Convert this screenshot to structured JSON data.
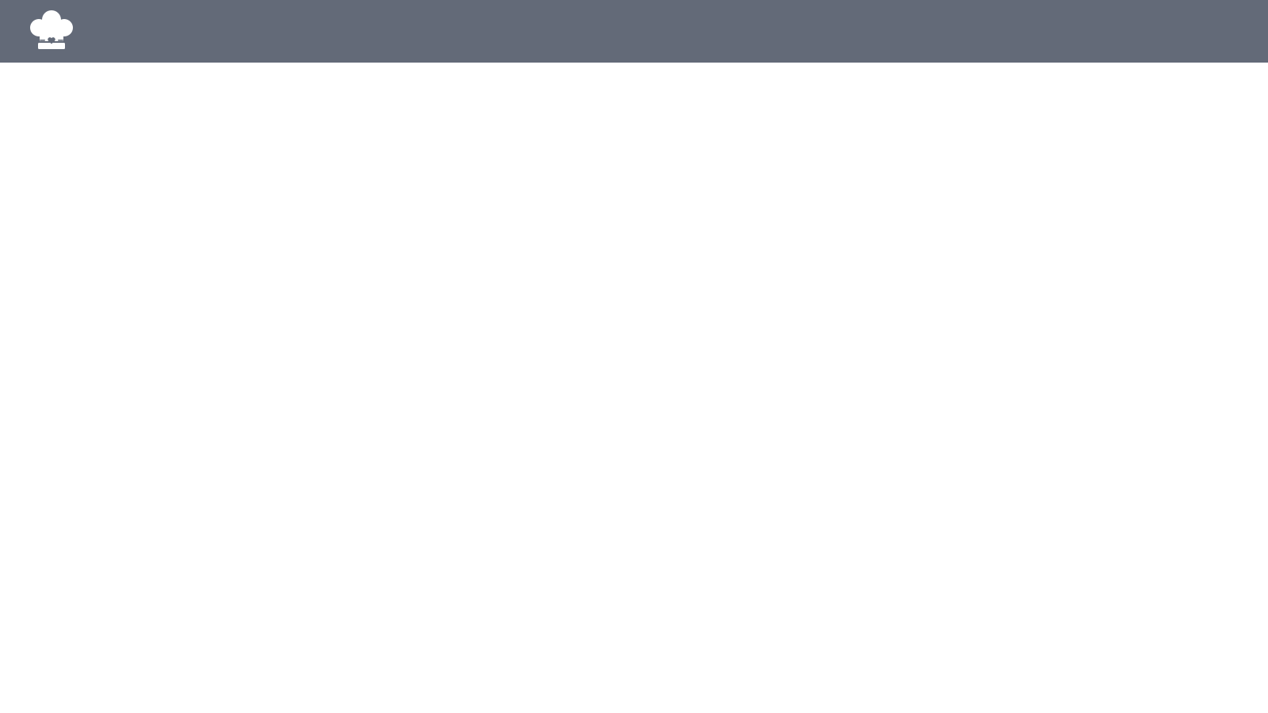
{
  "header": {
    "background_color": "#636a78",
    "logo": {
      "icon": "chef-hat-heart-icon",
      "color": "#ffffff",
      "accent_color": "#636a78"
    }
  },
  "main": {
    "background_color": "#ffffff"
  }
}
